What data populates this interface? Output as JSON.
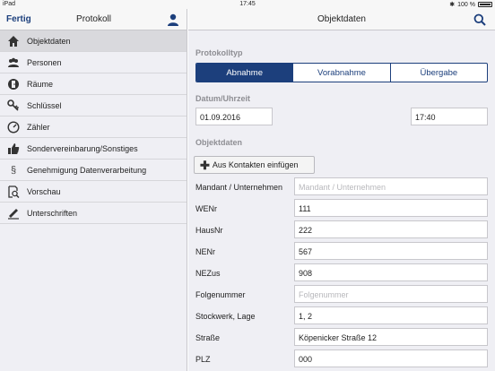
{
  "status": {
    "device": "iPad",
    "time": "17:45",
    "battery": "100 %"
  },
  "left": {
    "done_label": "Fertig",
    "title": "Protokoll",
    "menu": [
      {
        "label": "Objektdaten",
        "icon": "home-icon",
        "active": true
      },
      {
        "label": "Personen",
        "icon": "people-icon",
        "active": false
      },
      {
        "label": "Räume",
        "icon": "room-icon",
        "active": false
      },
      {
        "label": "Schlüssel",
        "icon": "key-icon",
        "active": false
      },
      {
        "label": "Zähler",
        "icon": "meter-icon",
        "active": false
      },
      {
        "label": "Sondervereinbarung/Sonstiges",
        "icon": "thumbs-up-icon",
        "active": false
      },
      {
        "label": "Genehmigung Datenverarbeitung",
        "icon": "paragraph-icon",
        "active": false
      },
      {
        "label": "Vorschau",
        "icon": "preview-icon",
        "active": false
      },
      {
        "label": "Unterschriften",
        "icon": "pen-icon",
        "active": false
      }
    ]
  },
  "right": {
    "title": "Objektdaten",
    "protokolltyp_label": "Protokolltyp",
    "segments": [
      "Abnahme",
      "Vorabnahme",
      "Übergabe"
    ],
    "selected_segment": "Abnahme",
    "datetime_label": "Datum/Uhrzeit",
    "date": "01.09.2016",
    "time": "17:40",
    "objektdaten_label": "Objektdaten",
    "add_button": "Aus Kontakten einfügen",
    "fields": [
      {
        "label": "Mandant / Unternehmen",
        "value": "",
        "placeholder": "Mandant / Unternehmen"
      },
      {
        "label": "WENr",
        "value": "111",
        "placeholder": ""
      },
      {
        "label": "HausNr",
        "value": "222",
        "placeholder": ""
      },
      {
        "label": "NENr",
        "value": "567",
        "placeholder": ""
      },
      {
        "label": "NEZus",
        "value": "908",
        "placeholder": ""
      },
      {
        "label": "Folgenummer",
        "value": "",
        "placeholder": "Folgenummer"
      },
      {
        "label": "Stockwerk, Lage",
        "value": "1, 2",
        "placeholder": ""
      },
      {
        "label": "Straße",
        "value": "Köpenicker Straße 12",
        "placeholder": ""
      },
      {
        "label": "PLZ",
        "value": "000",
        "placeholder": ""
      }
    ]
  }
}
